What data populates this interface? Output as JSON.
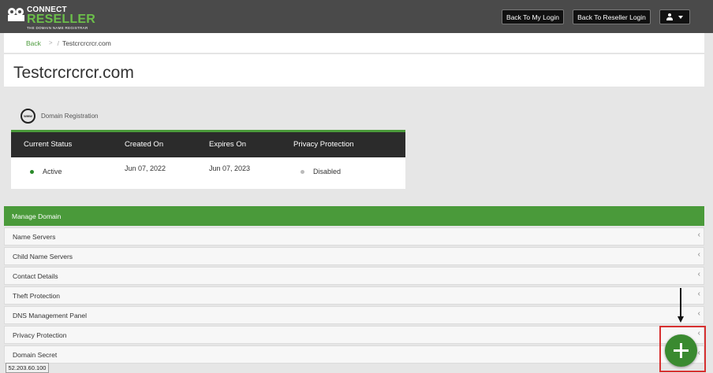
{
  "header": {
    "logo_connect": "CONNECT",
    "logo_reseller": "RESELLER",
    "logo_tagline": "THE DOMAIN NAME REGISTRAR",
    "back_to_my_login": "Back To My Login",
    "back_to_reseller_login": "Back To Reseller Login",
    "user_menu_icon": "user-icon",
    "brand_color": "#6cc04a"
  },
  "breadcrumb": {
    "back": "Back",
    "separator": ">",
    "separator2": "/",
    "current": "Testcrcrcrcr.com"
  },
  "page_title": "Testcrcrcrcr.com",
  "registration": {
    "icon": "www-globe-icon",
    "label": "Domain Registration",
    "columns": [
      "Current Status",
      "Created On",
      "Expires On",
      "Privacy Protection"
    ],
    "status": "Active",
    "created_on": "Jun 07, 2022",
    "expires_on": "Jun 07, 2023",
    "privacy": "Disabled",
    "status_color": "#2a8a2a",
    "privacy_color": "#bbbbbb"
  },
  "manage": {
    "heading": "Manage Domain",
    "accent": "#4a9a3a",
    "items": [
      {
        "label": "Name Servers"
      },
      {
        "label": "Child Name Servers"
      },
      {
        "label": "Contact Details"
      },
      {
        "label": "Theft Protection"
      },
      {
        "label": "DNS Management Panel"
      },
      {
        "label": "Privacy Protection"
      },
      {
        "label": "Domain Secret"
      }
    ],
    "chevron": "‹"
  },
  "fab": {
    "icon": "plus-icon",
    "highlight_color": "#d63030"
  },
  "annotation": {
    "icon": "arrow-down-icon"
  },
  "status_bar": {
    "ip": "52.203.60.100"
  }
}
